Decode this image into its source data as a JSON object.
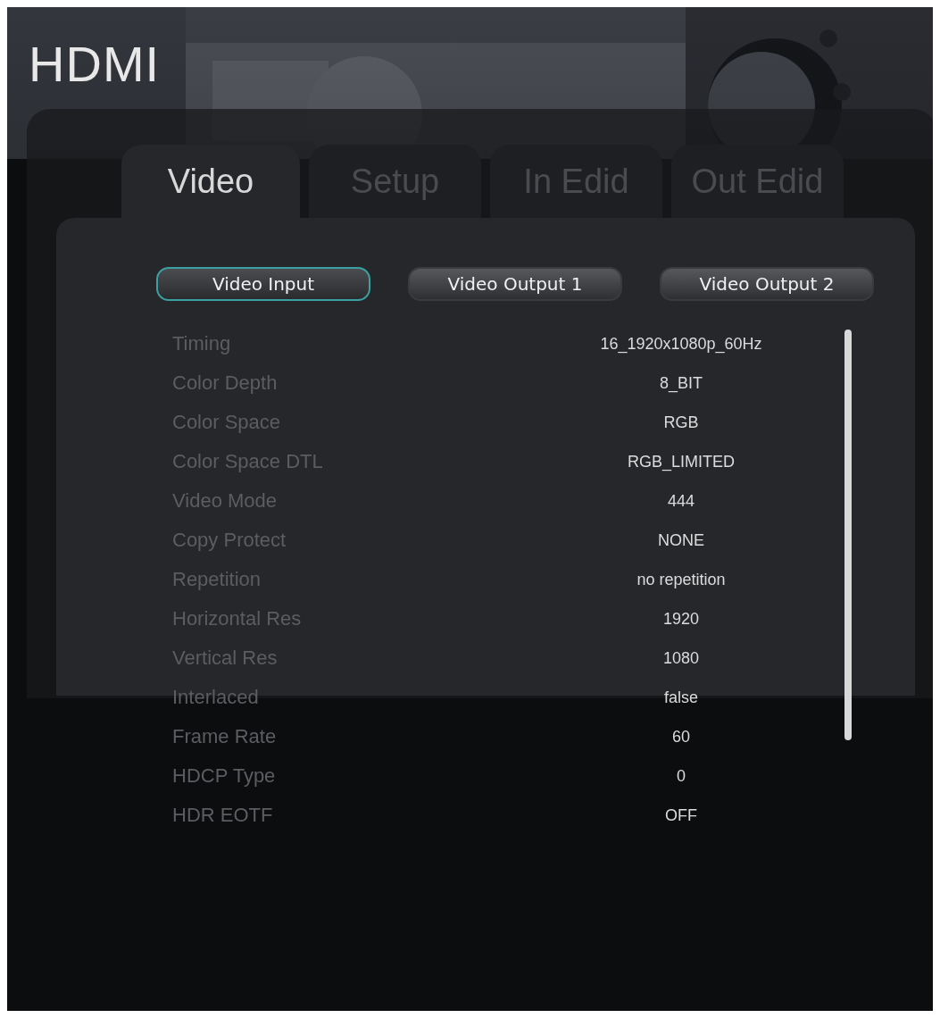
{
  "screen": {
    "title": "HDMI"
  },
  "tabs": [
    {
      "label": "Video",
      "selected": true
    },
    {
      "label": "Setup",
      "selected": false
    },
    {
      "label": "In Edid",
      "selected": false
    },
    {
      "label": "Out Edid",
      "selected": false
    }
  ],
  "sub_tabs": [
    {
      "label": "Video Input",
      "selected": true
    },
    {
      "label": "Video Output 1",
      "selected": false
    },
    {
      "label": "Video Output 2",
      "selected": false
    }
  ],
  "rows": [
    {
      "label": "Timing",
      "value": "16_1920x1080p_60Hz"
    },
    {
      "label": "Color Depth",
      "value": "8_BIT"
    },
    {
      "label": "Color Space",
      "value": "RGB"
    },
    {
      "label": "Color Space DTL",
      "value": "RGB_LIMITED"
    },
    {
      "label": "Video Mode",
      "value": "444"
    },
    {
      "label": "Copy Protect",
      "value": "NONE"
    },
    {
      "label": "Repetition",
      "value": "no repetition"
    },
    {
      "label": "Horizontal Res",
      "value": "1920"
    },
    {
      "label": "Vertical Res",
      "value": "1080"
    },
    {
      "label": "Interlaced",
      "value": "false"
    },
    {
      "label": "Frame Rate",
      "value": "60"
    },
    {
      "label": "HDCP Type",
      "value": "0"
    },
    {
      "label": "HDR EOTF",
      "value": "OFF"
    }
  ]
}
